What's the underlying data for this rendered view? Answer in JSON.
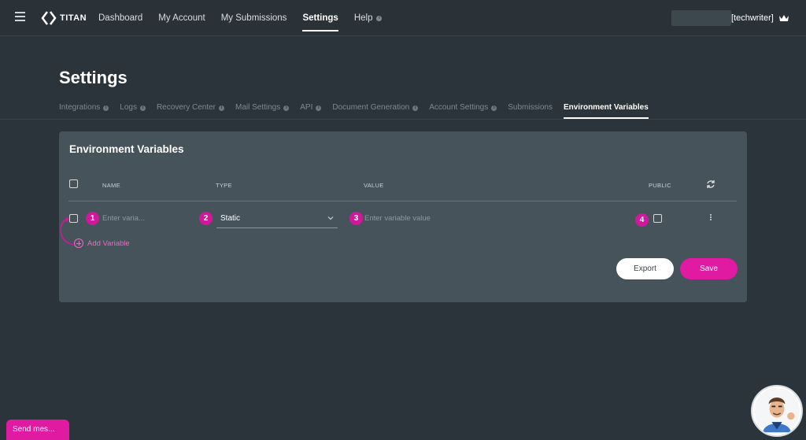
{
  "nav": {
    "brand": "TITAN",
    "links": [
      {
        "label": "Dashboard"
      },
      {
        "label": "My Account"
      },
      {
        "label": "My Submissions"
      },
      {
        "label": "Settings"
      },
      {
        "label": "Help"
      }
    ],
    "username": "[techwriter]"
  },
  "page": {
    "title": "Settings",
    "tabs": [
      {
        "label": "Integrations"
      },
      {
        "label": "Logs"
      },
      {
        "label": "Recovery Center"
      },
      {
        "label": "Mail Settings"
      },
      {
        "label": "API"
      },
      {
        "label": "Document Generation"
      },
      {
        "label": "Account Settings"
      },
      {
        "label": "Submissions"
      },
      {
        "label": "Environment Variables"
      }
    ],
    "active_tab": "Environment Variables"
  },
  "panel": {
    "title": "Environment Variables",
    "columns": {
      "name": "NAME",
      "type": "TYPE",
      "value": "VALUE",
      "public": "PUBLIC"
    },
    "row": {
      "name_placeholder": "Enter varia...",
      "type_value": "Static",
      "value_placeholder": "Enter variable value"
    },
    "badges": [
      "1",
      "2",
      "3",
      "4"
    ],
    "add_label": "Add Variable",
    "export_label": "Export",
    "save_label": "Save"
  },
  "widgets": {
    "send_message": "Send mes..."
  },
  "colors": {
    "accent": "#e01aa1",
    "badge": "#d1179c",
    "panel_bg": "#47535a",
    "page_bg": "#2b343b"
  },
  "icons": {
    "menu": "hamburger-icon",
    "info": "info-icon",
    "refresh": "refresh-icon",
    "kebab": "kebab-menu-icon",
    "chevron": "chevron-down-icon",
    "add": "plus-circle-icon",
    "crown": "crown-icon"
  }
}
